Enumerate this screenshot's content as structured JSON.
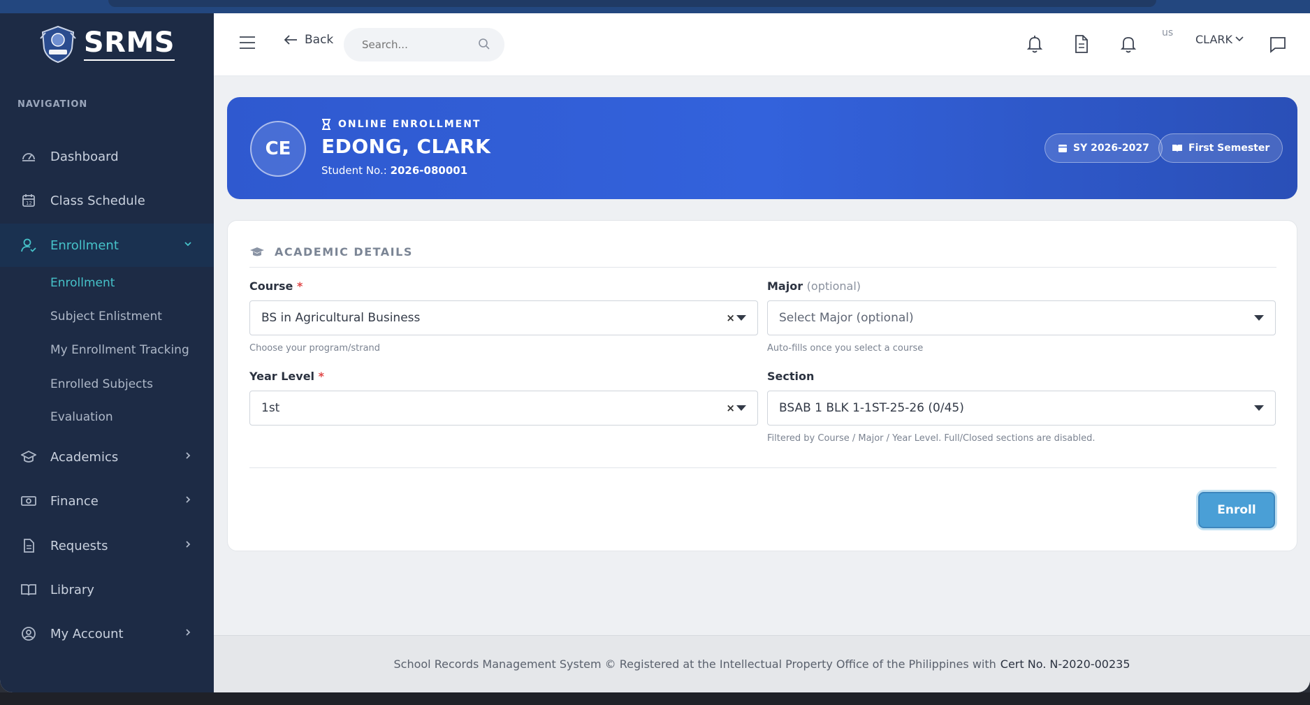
{
  "brand": {
    "name": "SRMS"
  },
  "sidebar": {
    "heading": "NAVIGATION",
    "items": [
      {
        "label": "Dashboard",
        "icon": "gauge-icon"
      },
      {
        "label": "Class Schedule",
        "icon": "calendar-icon"
      },
      {
        "label": "Enrollment",
        "icon": "user-check-icon",
        "expanded": true
      },
      {
        "label": "Academics",
        "icon": "graduation-cap-icon"
      },
      {
        "label": "Finance",
        "icon": "money-icon"
      },
      {
        "label": "Requests",
        "icon": "document-icon"
      },
      {
        "label": "Library",
        "icon": "book-icon"
      },
      {
        "label": "My Account",
        "icon": "user-circle-icon"
      }
    ],
    "enrollment_sub": [
      {
        "label": "Enrollment",
        "active": true
      },
      {
        "label": "Subject Enlistment"
      },
      {
        "label": "My Enrollment Tracking"
      },
      {
        "label": "Enrolled Subjects"
      },
      {
        "label": "Evaluation"
      }
    ]
  },
  "header": {
    "back_label": "Back",
    "search_placeholder": "Search...",
    "avatar_alt": "us",
    "user_name": "CLARK"
  },
  "banner": {
    "initials": "CE",
    "tag": "ONLINE ENROLLMENT",
    "student_name": "EDONG, CLARK",
    "student_no_label": "Student No.:",
    "student_no": "2026-080001",
    "school_year": "SY 2026-2027",
    "semester": "First Semester"
  },
  "form": {
    "section_title": "ACADEMIC DETAILS",
    "course": {
      "label": "Course",
      "required": "*",
      "value": "BS in Agricultural Business",
      "help": "Choose your program/strand"
    },
    "major": {
      "label": "Major",
      "optional": "(optional)",
      "placeholder": "Select Major (optional)",
      "help": "Auto-fills once you select a course"
    },
    "year_level": {
      "label": "Year Level",
      "required": "*",
      "value": "1st"
    },
    "section": {
      "label": "Section",
      "value": "BSAB 1 BLK 1-1ST-25-26 (0/45)",
      "help": "Filtered by Course / Major / Year Level. Full/Closed sections are disabled."
    },
    "clear_symbol": "×",
    "enroll_label": "Enroll"
  },
  "footer": {
    "text": "School Records Management System © Registered at the Intellectual Property Office of the Philippines with",
    "cert": "Cert No. N-2020-00235"
  },
  "colors": {
    "sidebar": "#1d2b45",
    "accent": "#46c2c9",
    "banner": "#3362dc",
    "button": "#4a9fd6"
  }
}
